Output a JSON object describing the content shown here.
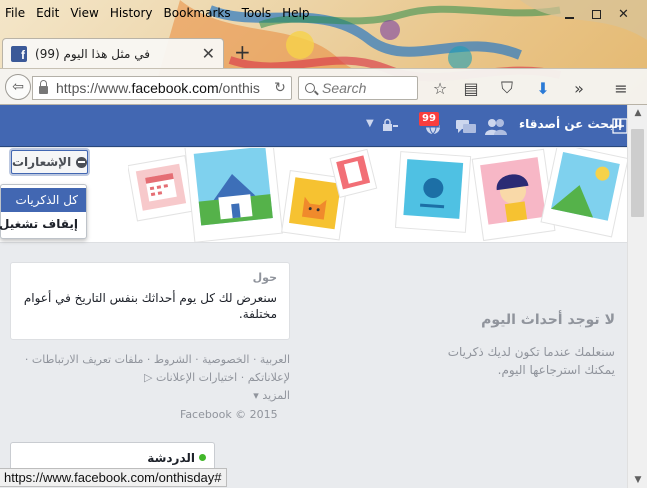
{
  "browser": {
    "menu": [
      "File",
      "Edit",
      "View",
      "History",
      "Bookmarks",
      "Tools",
      "Help"
    ],
    "tab": {
      "title": "في مثل هذا اليوم (99)",
      "favicon": "f"
    },
    "new_tab": "+",
    "url": {
      "prefix": "https://www.",
      "host": "facebook.com",
      "rest": "/onthis"
    },
    "search_placeholder": "Search",
    "status_url": "https://www.facebook.com/onthisday#"
  },
  "bluebar": {
    "find_friends": "البحث عن أصدقاء",
    "notification_count": "99"
  },
  "hero": {
    "notifications_button": "الإشعارات",
    "dropdown": {
      "item_all": "كل الذكريات",
      "item_off": "إيقاف تشغيل",
      "check": "✔"
    }
  },
  "about": {
    "title": "حول",
    "body": "سنعرض لك كل يوم أحداثك بنفس التاريخ في أعوام مختلفة."
  },
  "footer": {
    "links": "العربية · الخصوصية · الشروط · ملفات تعريف الارتباطات · لإعلاناتكم · اختيارات الإعلانات",
    "more": "المزيد ▾",
    "copyright": "Facebook © 2015"
  },
  "empty_state": {
    "title": "لا توجد أحداث اليوم",
    "body": "سنعلمك عندما تكون لديك ذكريات يمكنك استرجاعها اليوم."
  },
  "chat": {
    "label": "الدردشة"
  },
  "colors": {
    "facebook_blue": "#4267b2",
    "badge_red": "#fa3e3e",
    "online_green": "#42b72a"
  }
}
